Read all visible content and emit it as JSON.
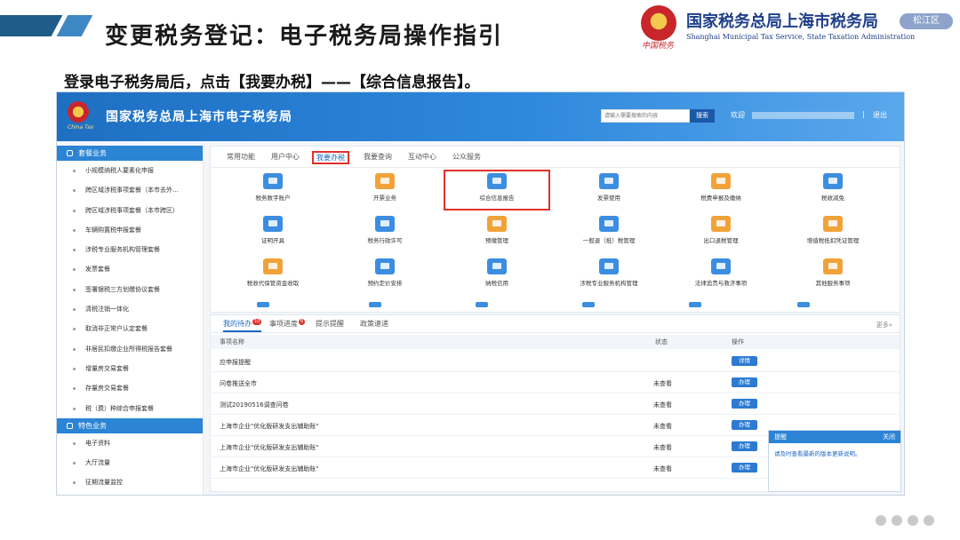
{
  "slide": {
    "title": "变更税务登记：电子税务局操作指引",
    "org_name": "国家税务总局上海市税务局",
    "org_name_en": "Shanghai Municipal Tax Service, State Taxation Administration",
    "logo_script": "中国税务",
    "district_badge": "松江区",
    "instruction": "登录电子税务局后，点击【我要办税】——【综合信息报告】。"
  },
  "portal": {
    "title": "国家税务总局上海市电子税务局",
    "logo_script": "China Tax",
    "search_placeholder": "请输入需要搜索的内容",
    "search_button": "搜索",
    "welcome": "欢迎",
    "separator": "|",
    "logout": "退出"
  },
  "sidebar": {
    "section1_title": "套餐业务",
    "section1_items": [
      "小规模纳税人要素化申报",
      "跨区域涉税事项套餐（本市去外…",
      "跨区域涉税事项套餐（本市跨区）",
      "车辆购置税申报套餐",
      "涉税专业服务机构管理套餐",
      "发票套餐",
      "签署银税三方划缴协议套餐",
      "清税注销一体化",
      "取消非正常户认定套餐",
      "非居民扣缴企业所得税报告套餐",
      "增量房交易套餐",
      "存量房交易套餐",
      "税（费）种综合申报套餐"
    ],
    "section2_title": "特色业务",
    "section2_items": [
      "电子资料",
      "大厅流量",
      "征期流量监控"
    ]
  },
  "main": {
    "tabs": [
      "常用功能",
      "用户中心",
      "我要办税",
      "我要查询",
      "互动中心",
      "公众服务"
    ],
    "active_tab": "我要办税",
    "functions": [
      {
        "label": "税务数字账户",
        "icon": "account-icon",
        "color": "#3b8ee0"
      },
      {
        "label": "开票业务",
        "icon": "invoice-issue-icon",
        "color": "#f0a33a"
      },
      {
        "label": "综合信息报告",
        "icon": "report-icon",
        "color": "#3b8ee0"
      },
      {
        "label": "发票使用",
        "icon": "invoice-use-icon",
        "color": "#3b8ee0"
      },
      {
        "label": "税费申报及缴纳",
        "icon": "tax-declare-icon",
        "color": "#f0a33a"
      },
      {
        "label": "税收减免",
        "icon": "tax-reduction-icon",
        "color": "#3b8ee0"
      },
      {
        "label": "证明开具",
        "icon": "certificate-icon",
        "color": "#3b8ee0"
      },
      {
        "label": "税务行政许可",
        "icon": "license-icon",
        "color": "#3b8ee0"
      },
      {
        "label": "预缴管理",
        "icon": "prepay-icon",
        "color": "#f0a33a"
      },
      {
        "label": "一般退（抵）税管理",
        "icon": "refund-icon",
        "color": "#3b8ee0"
      },
      {
        "label": "出口退税管理",
        "icon": "export-refund-icon",
        "color": "#f0a33a"
      },
      {
        "label": "增值税抵扣凭证管理",
        "icon": "vat-voucher-icon",
        "color": "#f0a33a"
      },
      {
        "label": "税收代保管资金收取",
        "icon": "fund-icon",
        "color": "#f0a33a"
      },
      {
        "label": "预约定价安排",
        "icon": "pricing-icon",
        "color": "#3b8ee0"
      },
      {
        "label": "纳税信用",
        "icon": "credit-icon",
        "color": "#3b8ee0"
      },
      {
        "label": "涉税专业服务机构管理",
        "icon": "agency-icon",
        "color": "#3b8ee0"
      },
      {
        "label": "法律追责与救济事项",
        "icon": "legal-icon",
        "color": "#3b8ee0"
      },
      {
        "label": "其他服务事项",
        "icon": "other-service-icon",
        "color": "#f0a33a"
      }
    ]
  },
  "tasks": {
    "tabs": [
      "我的待办",
      "事项进度",
      "提示提醒",
      "政策速递"
    ],
    "badges": [
      "10",
      "6"
    ],
    "more": "更多»",
    "headers": {
      "name": "事项名称",
      "status": "状态",
      "action": "操作"
    },
    "rows": [
      {
        "name": "应申报提醒",
        "status": "",
        "action": "详情"
      },
      {
        "name": "问卷推送全市",
        "status": "未查看",
        "action": "办理"
      },
      {
        "name": "测试20190516调查问卷",
        "status": "未查看",
        "action": "办理"
      },
      {
        "name": "上海市企业\"优化版研发支出辅助账\"",
        "status": "未查看",
        "action": "办理"
      },
      {
        "name": "上海市企业\"优化版研发支出辅助账\"",
        "status": "未查看",
        "action": "办理"
      },
      {
        "name": "上海市企业\"优化版研发支出辅助账\"",
        "status": "未查看",
        "action": "办理"
      }
    ]
  },
  "notice": {
    "title": "提醒",
    "close": "关闭",
    "body": "请及时查看最新的版本更新说明。"
  }
}
